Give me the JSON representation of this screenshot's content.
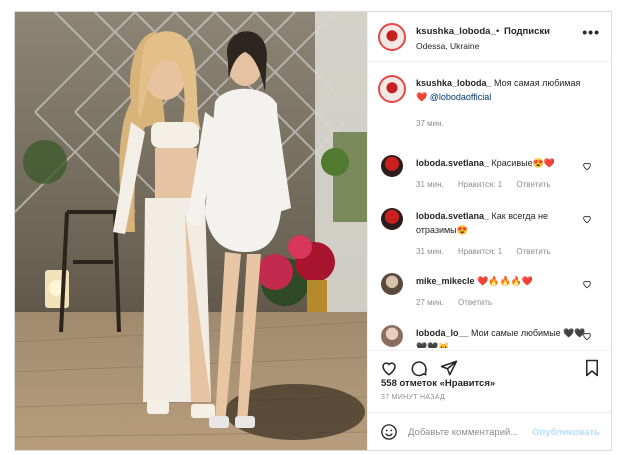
{
  "header": {
    "username": "ksushka_loboda_",
    "dot": "•",
    "follow_label": "Подписки",
    "location": "Odessa, Ukraine",
    "more": "•••"
  },
  "caption": {
    "username": "ksushka_loboda_",
    "text": "Моя самая любимая",
    "emoji": "❤️",
    "mention": "@lobodaofficial",
    "time": "37 мин."
  },
  "comments": [
    {
      "username": "loboda.svetlana_",
      "text": "Красивые",
      "emoji": "😍❤️",
      "time": "31 мин.",
      "likes": "Нравится: 1",
      "reply": "Ответить"
    },
    {
      "username": "loboda.svetlana_",
      "text": "Как всегда не отразимы",
      "emoji": "😍",
      "time": "31 мин.",
      "likes": "Нравится: 1",
      "reply": "Ответить"
    },
    {
      "username": "mike_mikecle",
      "text": "",
      "emoji": "❤️🔥🔥🔥❤️",
      "time": "27 мин.",
      "reply": "Ответить"
    },
    {
      "username": "loboda_lo__",
      "text": "Мои самые любимые",
      "emoji": "🖤🖤🖤🖤🐱"
    }
  ],
  "likes_count": "558 отметок «Нравится»",
  "posted_ago": "37 МИНУТ НАЗАД",
  "add_comment": {
    "placeholder": "Добавьте комментарий...",
    "publish": "Опубликовать"
  },
  "icons": [
    "heart-icon",
    "comment-icon",
    "share-icon",
    "bookmark-icon",
    "smile-icon",
    "more-icon"
  ],
  "colors": {
    "link": "#00376b",
    "publish_disabled": "#b2dffc",
    "border": "#dbdbdb",
    "heart_red": "#ed4956"
  }
}
